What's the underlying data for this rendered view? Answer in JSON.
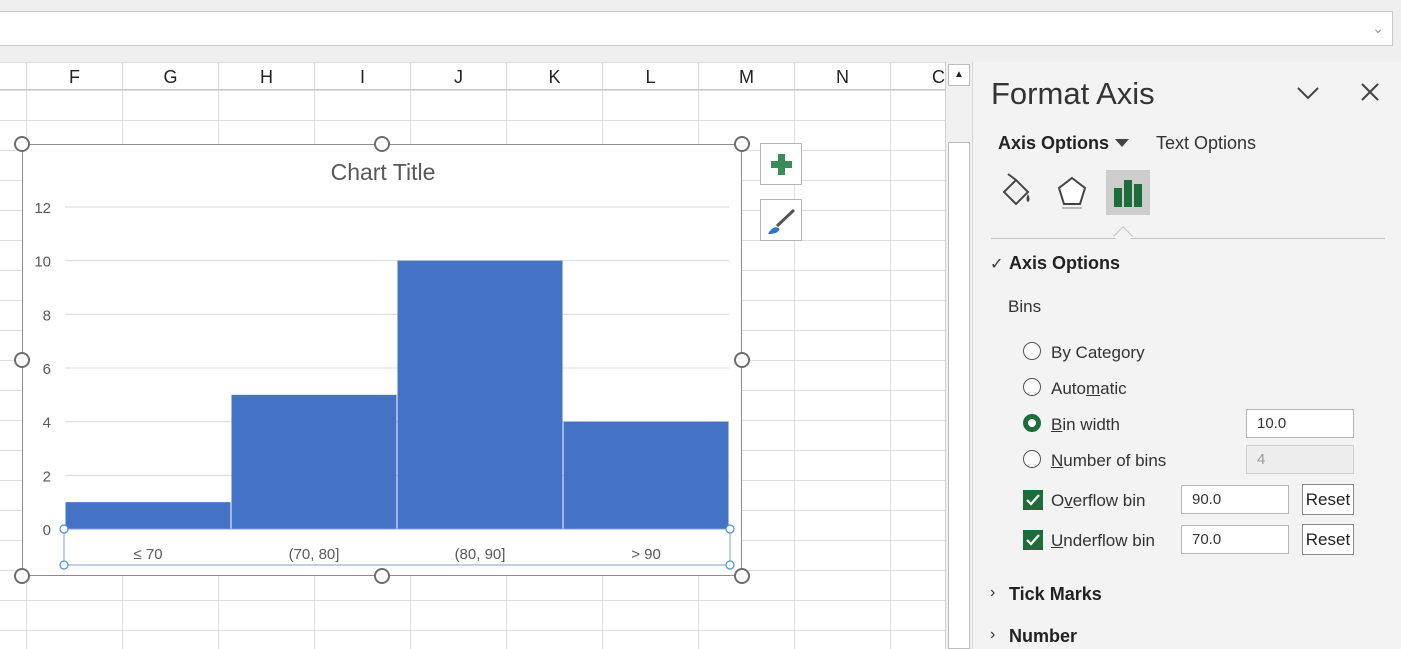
{
  "formula_bar": {
    "value": ""
  },
  "columns": [
    "F",
    "G",
    "H",
    "I",
    "J",
    "K",
    "L",
    "M",
    "N",
    "C"
  ],
  "chart": {
    "title": "Chart Title",
    "side_buttons": [
      "chart-elements-plus-icon",
      "chart-styles-brush-icon"
    ]
  },
  "chart_data": {
    "type": "bar",
    "title": "Chart Title",
    "categories": [
      "≤ 70",
      "(70, 80]",
      "(80, 90]",
      "> 90"
    ],
    "values": [
      1,
      5,
      10,
      4
    ],
    "ylim": [
      0,
      12
    ],
    "yticks": [
      "0",
      "2",
      "4",
      "6",
      "8",
      "10",
      "12"
    ],
    "color": "#4472c4",
    "grid": "horizontal"
  },
  "pane": {
    "title": "Format Axis",
    "tab_axis": "Axis Options",
    "tab_text": "Text Options",
    "icons": [
      "fill-line-icon",
      "effects-pentagon-icon",
      "axis-options-bar-chart-icon"
    ],
    "section_axis_options": "Axis Options",
    "bins_label": "Bins",
    "options": {
      "by_category": "By Category",
      "automatic": "Automatic",
      "bin_width": "Bin width",
      "bin_width_value": "10.0",
      "number_of_bins": "Number of bins",
      "number_of_bins_value": "4",
      "overflow_bin": "Overflow bin",
      "overflow_value": "90.0",
      "underflow_bin": "Underflow bin",
      "underflow_value": "70.0",
      "reset": "Reset"
    },
    "section_tick_marks": "Tick Marks",
    "section_number": "Number",
    "accent": "#1e6b3c"
  }
}
